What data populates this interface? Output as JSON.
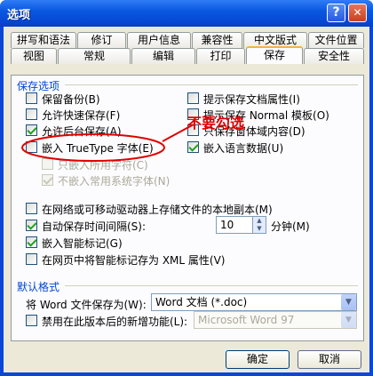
{
  "window": {
    "title": "选项",
    "help": "?",
    "close": "✕"
  },
  "tabs": {
    "row1": [
      "拼写和语法",
      "修订",
      "用户信息",
      "兼容性",
      "中文版式",
      "文件位置"
    ],
    "row2": [
      "视图",
      "常规",
      "编辑",
      "打印",
      "保存",
      "安全性"
    ],
    "active": "保存"
  },
  "save": {
    "group_title": "保存选项",
    "left": [
      {
        "label": "保留备份(B)",
        "checked": false
      },
      {
        "label": "允许快速保存(F)",
        "checked": false
      },
      {
        "label": "允许后台保存(A)",
        "checked": true
      },
      {
        "label": "嵌入 TrueType 字体(E)",
        "checked": false
      },
      {
        "label": "只嵌入所用字符(C)",
        "checked": false,
        "disabled": true
      },
      {
        "label": "不嵌入常用系统字体(N)",
        "checked": true,
        "disabled": true
      }
    ],
    "right": [
      {
        "label": "提示保存文档属性(I)",
        "checked": false
      },
      {
        "label": "提示保存 Normal 模板(O)",
        "checked": false
      },
      {
        "label": "只保存窗体域内容(D)",
        "checked": false
      },
      {
        "label": "嵌入语言数据(U)",
        "checked": true
      }
    ],
    "bottom": [
      {
        "label": "在网络或可移动驱动器上存储文件的本地副本(M)",
        "checked": false
      },
      {
        "label": "自动保存时间间隔(S):",
        "checked": true
      },
      {
        "label": "嵌入智能标记(G)",
        "checked": true
      },
      {
        "label": "在网页中将智能标记存为 XML 属性(V)",
        "checked": false
      }
    ],
    "autosave_minutes": "10",
    "minutes_label": "分钟(M)",
    "annotation": "不要勾选",
    "annotation_color": "#e00000"
  },
  "defaults": {
    "group_title": "默认格式",
    "save_as_label": "将 Word 文件保存为(W):",
    "save_as_value": "Word 文档 (*.doc)",
    "disable_label": "禁用在此版本后的新增功能(L):",
    "disable_value": "Microsoft Word 97"
  },
  "buttons": {
    "ok": "确定",
    "cancel": "取消"
  }
}
